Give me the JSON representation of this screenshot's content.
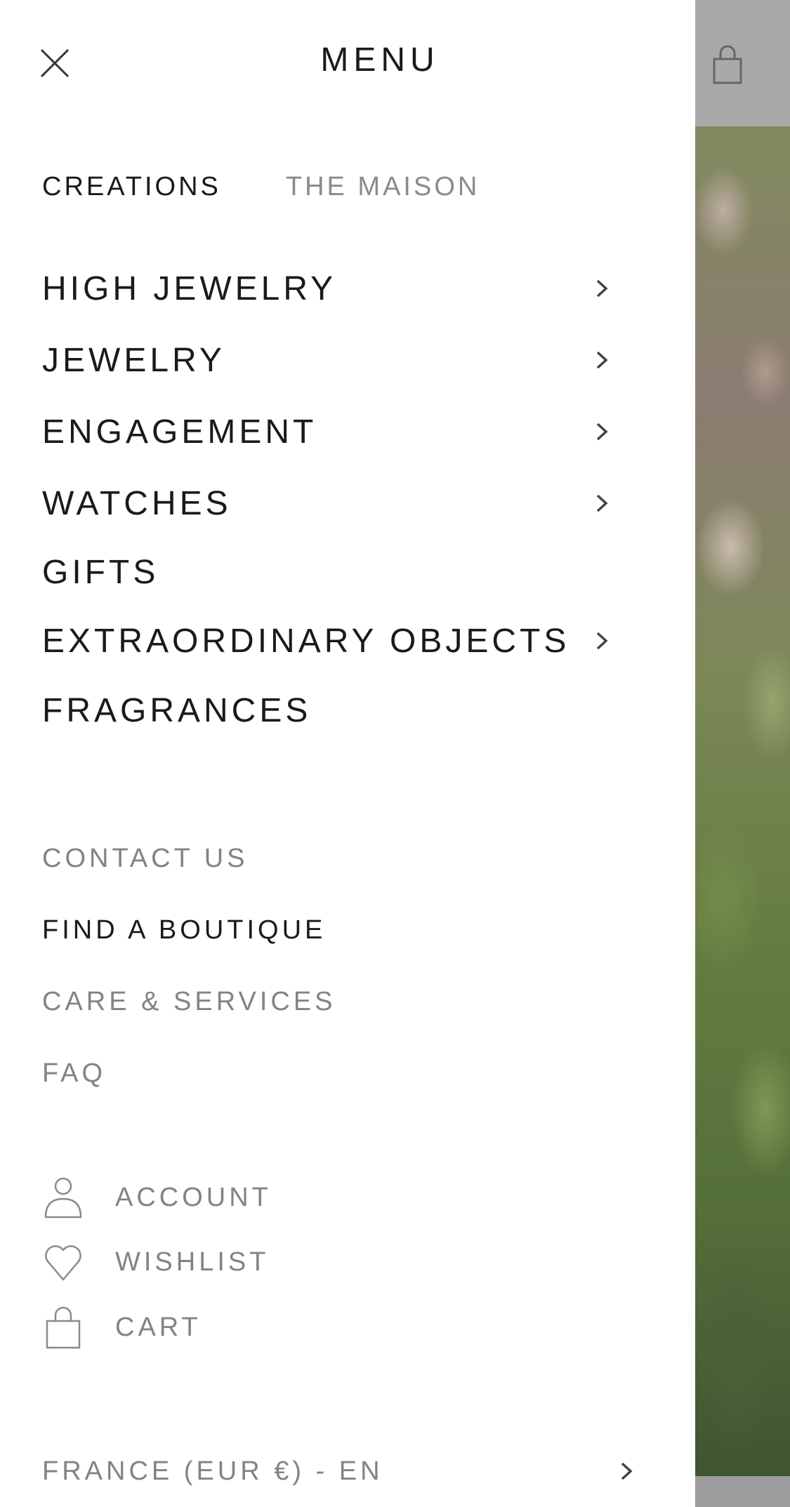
{
  "header": {
    "title": "MENU"
  },
  "tabs": [
    {
      "label": "CREATIONS",
      "active": true
    },
    {
      "label": "THE MAISON",
      "active": false
    }
  ],
  "main_menu": [
    {
      "label": "HIGH JEWELRY",
      "has_submenu": true
    },
    {
      "label": "JEWELRY",
      "has_submenu": true
    },
    {
      "label": "ENGAGEMENT",
      "has_submenu": true
    },
    {
      "label": "WATCHES",
      "has_submenu": true
    },
    {
      "label": "GIFTS",
      "has_submenu": false
    },
    {
      "label": "EXTRAORDINARY OBJECTS",
      "has_submenu": true
    },
    {
      "label": "FRAGRANCES",
      "has_submenu": false
    }
  ],
  "secondary_menu": [
    {
      "label": "CONTACT US"
    },
    {
      "label": "FIND A BOUTIQUE"
    },
    {
      "label": "CARE & SERVICES"
    },
    {
      "label": "FAQ"
    }
  ],
  "account_menu": [
    {
      "label": "ACCOUNT",
      "icon": "user-icon"
    },
    {
      "label": "WISHLIST",
      "icon": "heart-icon"
    },
    {
      "label": "CART",
      "icon": "shopping-bag-icon"
    }
  ],
  "locale": {
    "label": "FRANCE (EUR €) - EN"
  },
  "colors": {
    "text_dark": "#1a1a1a",
    "text_grey": "#838383",
    "backdrop": "#8f8f8f"
  }
}
